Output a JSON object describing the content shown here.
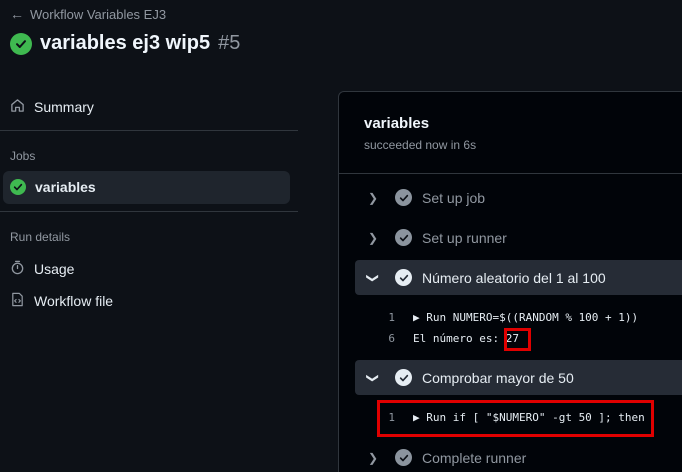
{
  "header": {
    "back_label": "Workflow Variables EJ3",
    "title": "variables ej3 wip5",
    "run_number": "#5"
  },
  "sidebar": {
    "summary_label": "Summary",
    "jobs_heading": "Jobs",
    "job_label": "variables",
    "run_details_heading": "Run details",
    "usage_label": "Usage",
    "workflow_file_label": "Workflow file"
  },
  "job": {
    "name": "variables",
    "status": "succeeded now in 6s",
    "steps": [
      {
        "label": "Set up job",
        "expanded": false
      },
      {
        "label": "Set up runner",
        "expanded": false
      },
      {
        "label": "Número aleatorio del 1 al 100",
        "expanded": true
      },
      {
        "label": "Comprobar mayor de 50",
        "expanded": true
      },
      {
        "label": "Complete runner",
        "expanded": false
      }
    ],
    "step3_log": [
      {
        "line": "1",
        "text": "▶ Run NUMERO=$((RANDOM % 100 + 1))"
      },
      {
        "line": "6",
        "text": "El número es: ",
        "value": "27"
      }
    ],
    "step4_log": [
      {
        "line": "1",
        "text": "▶ Run if [ \"$NUMERO\" -gt 50 ]; then"
      }
    ]
  },
  "colors": {
    "success": "#3fb950",
    "highlight": "#e00000",
    "background": "#0d1117"
  }
}
